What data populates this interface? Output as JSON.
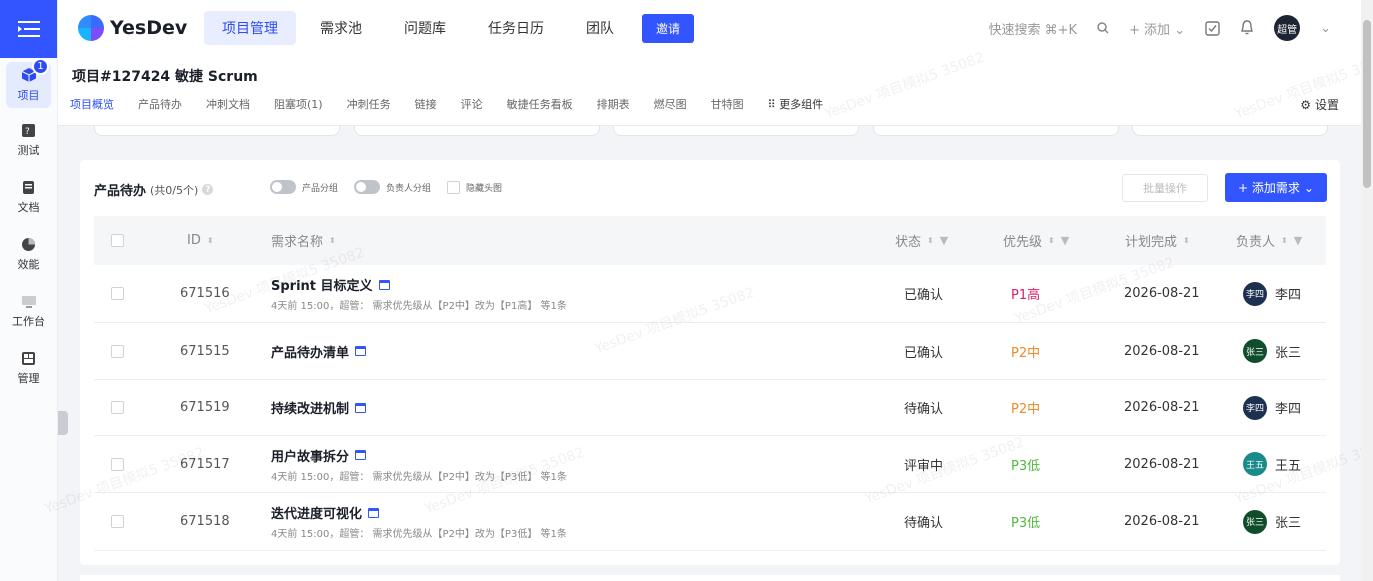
{
  "app": {
    "logo_text": "YesDev"
  },
  "rail": {
    "items": [
      {
        "label": "项目",
        "icon": "cube-icon",
        "badge": "1"
      },
      {
        "label": "测试",
        "icon": "bug-icon"
      },
      {
        "label": "文档",
        "icon": "document-icon"
      },
      {
        "label": "效能",
        "icon": "pie-chart-icon"
      },
      {
        "label": "工作台",
        "icon": "monitor-icon"
      },
      {
        "label": "管理",
        "icon": "grid-icon"
      }
    ]
  },
  "topnav": {
    "items": [
      "项目管理",
      "需求池",
      "问题库",
      "任务日历",
      "团队"
    ],
    "invite": "邀请",
    "search_hint": "快速搜索 ⌘+K",
    "add_label": "+ 添加",
    "user_avatar": "超管"
  },
  "project": {
    "title": "项目#127424 敏捷 Scrum",
    "tabs": [
      "项目概览",
      "产品待办",
      "冲刺文档",
      "阻塞项(1)",
      "冲刺任务",
      "链接",
      "评论",
      "敏捷任务看板",
      "排期表",
      "燃尽图",
      "甘特图"
    ],
    "more_label": "更多组件",
    "settings_label": "设置"
  },
  "backlog": {
    "title": "产品待办",
    "count": "(共0/5个)",
    "toggle_product": "产品分组",
    "toggle_owner": "负责人分组",
    "hide_header": "隐藏头图",
    "batch_label": "批量操作",
    "add_label": "+ 添加需求",
    "columns": {
      "id": "ID",
      "name": "需求名称",
      "status": "状态",
      "priority": "优先级",
      "due": "计划完成",
      "owner": "负责人"
    },
    "rows": [
      {
        "id": "671516",
        "name": "Sprint 目标定义",
        "sub": "4天前 15:00，超管： 需求优先级从【P2中】改为【P1高】 等1条",
        "status": "已确认",
        "priority": "P1高",
        "priority_color": "#d81e6b",
        "due": "2026-08-21",
        "owner": "李四",
        "owner_short": "李四",
        "owner_color": "#1e3050"
      },
      {
        "id": "671515",
        "name": "产品待办清单",
        "sub": "",
        "status": "已确认",
        "priority": "P2中",
        "priority_color": "#f08a24",
        "due": "2026-08-21",
        "owner": "张三",
        "owner_short": "张三",
        "owner_color": "#0f4d2c"
      },
      {
        "id": "671519",
        "name": "持续改进机制",
        "sub": "",
        "status": "待确认",
        "priority": "P2中",
        "priority_color": "#f08a24",
        "due": "2026-08-21",
        "owner": "李四",
        "owner_short": "李四",
        "owner_color": "#1e3050"
      },
      {
        "id": "671517",
        "name": "用户故事拆分",
        "sub": "4天前 15:00，超管： 需求优先级从【P2中】改为【P3低】 等1条",
        "status": "评审中",
        "priority": "P3低",
        "priority_color": "#52b83a",
        "due": "2026-08-21",
        "owner": "王五",
        "owner_short": "王五",
        "owner_color": "#1b8a8a"
      },
      {
        "id": "671518",
        "name": "迭代进度可视化",
        "sub": "4天前 15:00，超管： 需求优先级从【P2中】改为【P3低】 等1条",
        "status": "待确认",
        "priority": "P3低",
        "priority_color": "#52b83a",
        "due": "2026-08-21",
        "owner": "张三",
        "owner_short": "张三",
        "owner_color": "#0f4d2c"
      }
    ]
  },
  "watermark": "YesDev 项目模拟5 35082"
}
